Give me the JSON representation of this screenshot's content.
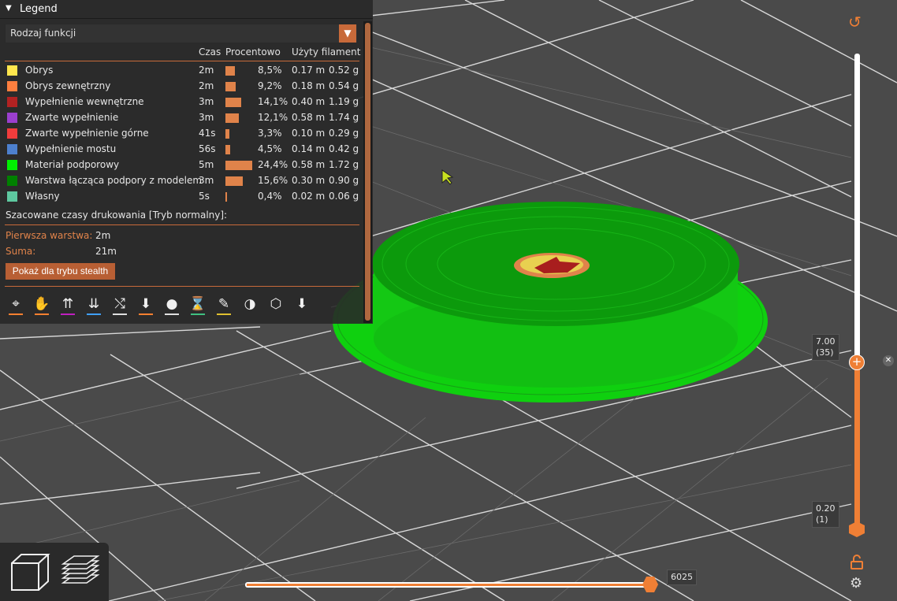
{
  "legend": {
    "title": "Legend",
    "feature_select": "Rodzaj funkcji",
    "columns": {
      "time": "Czas",
      "percent": "Procentowo",
      "filament": "Użyty filament"
    },
    "rows": [
      {
        "name": "Obrys",
        "color": "#ffe64d",
        "time": "2m",
        "percent": "8,5%",
        "length": "0.17 m",
        "weight": "0.52 g",
        "share": 8.5
      },
      {
        "name": "Obrys zewnętrzny",
        "color": "#ff7f3f",
        "time": "2m",
        "percent": "9,2%",
        "length": "0.18 m",
        "weight": "0.54 g",
        "share": 9.2
      },
      {
        "name": "Wypełnienie wewnętrzne",
        "color": "#b22222",
        "time": "3m",
        "percent": "14,1%",
        "length": "0.40 m",
        "weight": "1.19 g",
        "share": 14.1
      },
      {
        "name": "Zwarte wypełnienie",
        "color": "#9b3fce",
        "time": "3m",
        "percent": "12,1%",
        "length": "0.58 m",
        "weight": "1.74 g",
        "share": 12.1
      },
      {
        "name": "Zwarte wypełnienie górne",
        "color": "#f03c3c",
        "time": "41s",
        "percent": "3,3%",
        "length": "0.10 m",
        "weight": "0.29 g",
        "share": 3.3
      },
      {
        "name": "Wypełnienie mostu",
        "color": "#4d80ce",
        "time": "56s",
        "percent": "4,5%",
        "length": "0.14 m",
        "weight": "0.42 g",
        "share": 4.5
      },
      {
        "name": "Materiał podporowy",
        "color": "#00f000",
        "time": "5m",
        "percent": "24,4%",
        "length": "0.58 m",
        "weight": "1.72 g",
        "share": 24.4
      },
      {
        "name": "Warstwa łącząca podpory z modelem",
        "color": "#008000",
        "time": "3m",
        "percent": "15,6%",
        "length": "0.30 m",
        "weight": "0.90 g",
        "share": 15.6
      },
      {
        "name": "Własny",
        "color": "#5ec8a0",
        "time": "5s",
        "percent": "0,4%",
        "length": "0.02 m",
        "weight": "0.06 g",
        "share": 0.4
      }
    ],
    "estimated_title": "Szacowane czasy drukowania [Tryb normalny]:",
    "first_layer_label": "Pierwsza warstwa:",
    "first_layer_value": "2m",
    "total_label": "Suma:",
    "total_value": "21m",
    "stealth_button": "Pokaż dla trybu stealth",
    "toolbar": [
      {
        "icon": "travel-icon",
        "glyph": "⌖",
        "underline": "#ff8030"
      },
      {
        "icon": "wipe-icon",
        "glyph": "✋",
        "underline": "#ff8030"
      },
      {
        "icon": "retractions-icon",
        "glyph": "⇈",
        "underline": "#c020c0"
      },
      {
        "icon": "deretractions-icon",
        "glyph": "⇊",
        "underline": "#40a0ff"
      },
      {
        "icon": "seams-icon",
        "glyph": "⤭",
        "underline": "#e0e0e0"
      },
      {
        "icon": "tool-changes-icon",
        "glyph": "⬇",
        "underline": "#ff8030"
      },
      {
        "icon": "color-changes-icon",
        "glyph": "●",
        "underline": "#e0e0e0"
      },
      {
        "icon": "pause-icon",
        "glyph": "⌛",
        "underline": "#40c080"
      },
      {
        "icon": "custom-gcode-icon",
        "glyph": "✎",
        "underline": "#e0c030"
      },
      {
        "icon": "center-of-gravity-icon",
        "glyph": "◑",
        "underline": ""
      },
      {
        "icon": "shells-icon",
        "glyph": "⬡",
        "underline": ""
      },
      {
        "icon": "tool-marker-icon",
        "glyph": "⬇",
        "underline": ""
      }
    ]
  },
  "vertical_slider": {
    "upper_value": "7.00",
    "upper_layer": "(35)",
    "lower_value": "0.20",
    "lower_layer": "(1)"
  },
  "horizontal_slider": {
    "value": "6025"
  },
  "colors": {
    "accent": "#ef7f35",
    "grid_bg": "#4a4a4a"
  }
}
